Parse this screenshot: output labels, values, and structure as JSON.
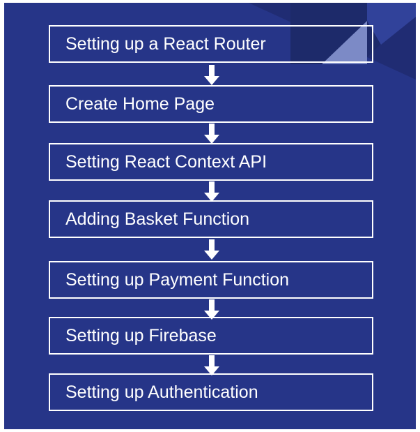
{
  "flowchart": {
    "steps": [
      "Setting up a React Router",
      "Create Home Page",
      "Setting React Context API",
      "Adding Basket Function",
      "Setting up Payment Function",
      "Setting up Firebase",
      "Setting up Authentication"
    ],
    "colors": {
      "background": "#263588",
      "box_border": "#ffffff",
      "text": "#ffffff",
      "arrow": "#ffffff"
    },
    "arrow_icon": "arrow-down-icon"
  }
}
